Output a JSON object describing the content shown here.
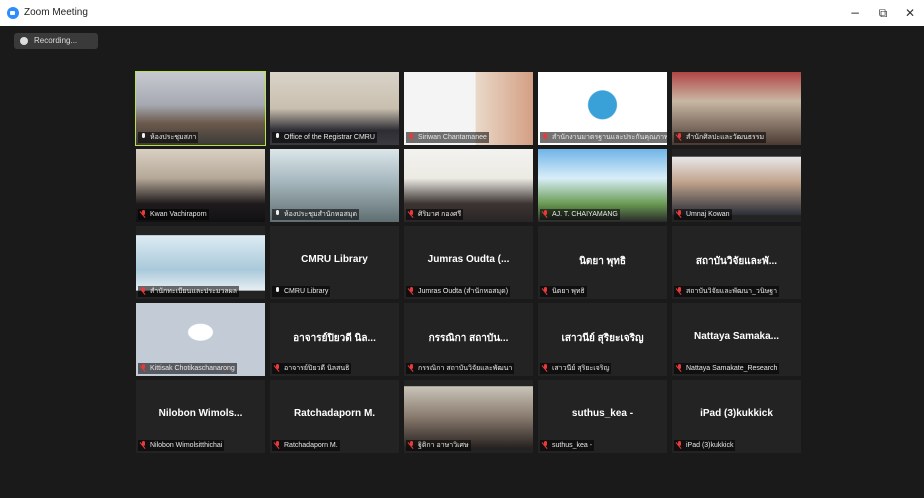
{
  "window": {
    "title": "Zoom Meeting",
    "minimize": "−",
    "restore": "⧉",
    "close": "✕"
  },
  "recording": {
    "label": "Recording...",
    "icon": "cloud-record-icon"
  },
  "colors": {
    "active_speaker": "#b7e34a",
    "muted": "#e8393b",
    "tile_bg": "#232323"
  },
  "participants": [
    {
      "label": "ห้องประชุมสภา",
      "video": true,
      "muted": false,
      "active": true
    },
    {
      "label": "Office of the Registrar CMRU",
      "video": true,
      "muted": false
    },
    {
      "label": "Siriwan Chantamanee",
      "video": true,
      "muted": true
    },
    {
      "label": "สำนักงานมาตรฐานและประกันคุณภาพ",
      "video": true,
      "muted": true
    },
    {
      "label": "สำนักศิลปะและวัฒนธรรม",
      "video": true,
      "muted": true
    },
    {
      "label": "Kwan Vachiraporn",
      "video": true,
      "muted": true
    },
    {
      "label": "ห้องประชุมสำนักหอสมุด",
      "video": true,
      "muted": false
    },
    {
      "label": "ศิริมาศ  กองศรี",
      "video": true,
      "muted": true
    },
    {
      "label": "AJ. T. CHAIYAMANG",
      "video": true,
      "muted": true
    },
    {
      "label": "Umnaj Kowan",
      "video": true,
      "muted": true
    },
    {
      "label": "สำนักทะเบียนและประมวลผล",
      "video": true,
      "muted": true
    },
    {
      "name": "CMRU Library",
      "label": "CMRU Library",
      "video": false,
      "muted": false
    },
    {
      "name": "Jumras Oudta (...",
      "label": "Jumras Oudta (สำนักหอสมุด)",
      "video": false,
      "muted": true
    },
    {
      "name": "นิตยา  พุทธิ",
      "label": "นิตยา  พุทธิ",
      "video": false,
      "muted": true
    },
    {
      "name": "สถาบันวิจัยและพั...",
      "label": "สถาบันวิจัยและพัฒนา_วนิษฐา",
      "video": false,
      "muted": true
    },
    {
      "label": "Kittisak Chotikaschanarong",
      "video": true,
      "muted": true
    },
    {
      "name": "อาจารย์ปิยวดี นิล...",
      "label": "อาจารย์ปิยวดี นิลสนธิ",
      "video": false,
      "muted": true
    },
    {
      "name": "กรรณิกา  สถาบัน...",
      "label": "กรรณิกา  สถาบันวิจัยและพัฒนา",
      "video": false,
      "muted": true
    },
    {
      "name": "เสาวนีย์ สุริยะเจริญ",
      "label": "เสาวนีย์ สุริยะเจริญ",
      "video": false,
      "muted": true
    },
    {
      "name": "Nattaya  Samaka...",
      "label": "Nattaya Samakate_Research",
      "video": false,
      "muted": true
    },
    {
      "name": "Nilobon  Wimols...",
      "label": "Nilobon Wimolsitthichai",
      "video": false,
      "muted": true
    },
    {
      "name": "Ratchadaporn M.",
      "label": "Ratchadaporn M.",
      "video": false,
      "muted": true
    },
    {
      "label": "ฐิติกา  อาษาวิเศษ",
      "video": true,
      "muted": true
    },
    {
      "name": "suthus_kea -",
      "label": "suthus_kea -",
      "video": false,
      "muted": true
    },
    {
      "name": "iPad (3)kukkick",
      "label": "iPad (3)kukkick",
      "video": false,
      "muted": true
    }
  ]
}
